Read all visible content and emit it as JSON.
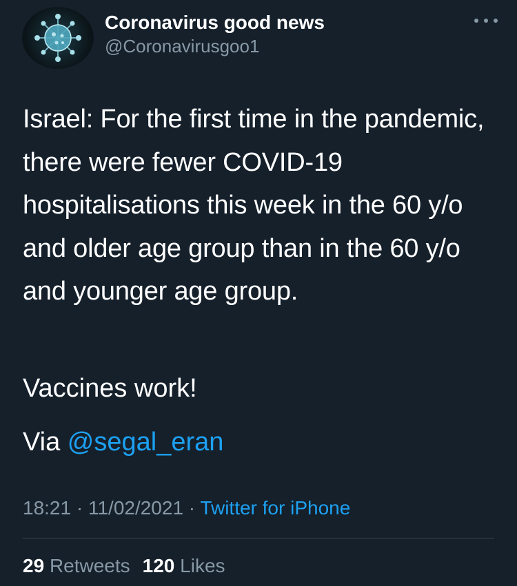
{
  "user": {
    "display_name": "Coronavirus good news",
    "handle": "@Coronavirusgoo1",
    "avatar_icon": "virus-icon"
  },
  "tweet": {
    "paragraph_1": "Israel: For the first time in the pandemic, there were fewer COVID-19 hospitalisations this week in the 60 y/o and older age group than in the 60 y/o and younger age group.",
    "paragraph_2": "Vaccines work!",
    "paragraph_3_prefix": "Via ",
    "mention": "@segal_eran"
  },
  "meta": {
    "time": "18:21",
    "separator": " · ",
    "date": "11/02/2021",
    "source": "Twitter for iPhone"
  },
  "stats": {
    "retweets_count": "29",
    "retweets_label": "Retweets",
    "likes_count": "120",
    "likes_label": "Likes"
  },
  "colors": {
    "background": "#15202b",
    "accent": "#1da1f2",
    "secondary_text": "#8899a6",
    "divider": "#38444d"
  }
}
